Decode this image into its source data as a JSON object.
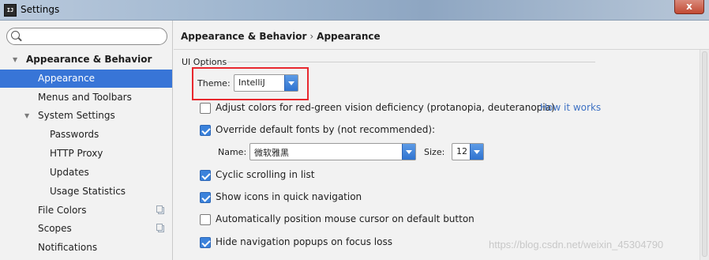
{
  "window": {
    "title": "Settings",
    "app_icon_text": "IJ",
    "close_label": "x"
  },
  "search": {
    "value": "",
    "placeholder": ""
  },
  "sidebar": {
    "items": [
      {
        "label": "Appearance & Behavior"
      },
      {
        "label": "Appearance"
      },
      {
        "label": "Menus and Toolbars"
      },
      {
        "label": "System Settings"
      },
      {
        "label": "Passwords"
      },
      {
        "label": "HTTP Proxy"
      },
      {
        "label": "Updates"
      },
      {
        "label": "Usage Statistics"
      },
      {
        "label": "File Colors"
      },
      {
        "label": "Scopes"
      },
      {
        "label": "Notifications"
      }
    ]
  },
  "main": {
    "breadcrumb": {
      "parent": "Appearance & Behavior",
      "separator": "›",
      "current": "Appearance"
    },
    "section": "UI Options",
    "theme": {
      "label": "Theme:",
      "value": "IntelliJ"
    },
    "options": {
      "adjust_colors": {
        "label": "Adjust colors for red-green vision deficiency (protanopia, deuteranopia)",
        "checked": false,
        "link": "How it works"
      },
      "override_fonts": {
        "label": "Override default fonts by (not recommended):",
        "checked": true
      },
      "cyclic_scrolling": {
        "label": "Cyclic scrolling in list",
        "checked": true
      },
      "show_icons": {
        "label": "Show icons in quick navigation",
        "checked": true
      },
      "auto_position": {
        "label": "Automatically position mouse cursor on default button",
        "checked": false
      },
      "hide_popups": {
        "label": "Hide navigation popups on focus loss",
        "checked": true
      }
    },
    "font": {
      "name_label": "Name:",
      "name_value": "微软雅黑",
      "size_label": "Size:",
      "size_value": "12"
    }
  },
  "watermark": "https://blog.csdn.net/weixin_45304790",
  "colors": {
    "selection": "#3875d7",
    "checkbox": "#3b82db",
    "link": "#3f72c4",
    "highlight": "#e8282e"
  }
}
